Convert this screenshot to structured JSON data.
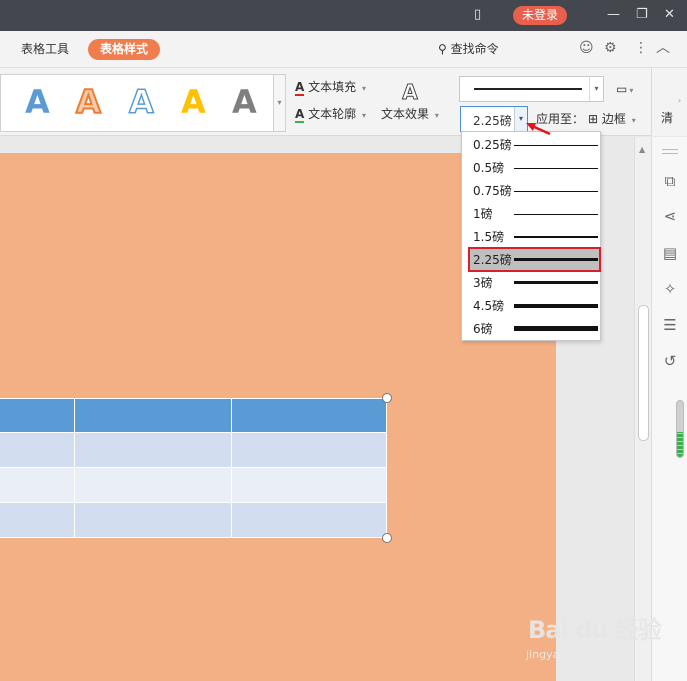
{
  "titlebar": {
    "login_label": "未登录"
  },
  "menubar": {
    "tabs": [
      {
        "label": "表格工具"
      },
      {
        "label": "表格样式"
      }
    ],
    "search_label": "查找命令"
  },
  "ribbon": {
    "text_fill_label": "文本填充",
    "text_outline_label": "文本轮廓",
    "text_effect_label": "文本效果",
    "art_letter": "A",
    "line_weight_value": "2.25磅",
    "apply_to_label": "应用至：",
    "border_label": "边框",
    "clear_label": "清"
  },
  "weight_dropdown": {
    "items": [
      {
        "label": "0.25磅"
      },
      {
        "label": "0.5磅"
      },
      {
        "label": "0.75磅"
      },
      {
        "label": "1磅"
      },
      {
        "label": "1.5磅"
      },
      {
        "label": "2.25磅",
        "selected": true
      },
      {
        "label": "3磅"
      },
      {
        "label": "4.5磅"
      },
      {
        "label": "6磅"
      }
    ]
  },
  "watermark": {
    "logo": "Bai du 经验",
    "sub": "jingyan.baidu.com"
  },
  "colors": {
    "page_background": "#f4b085",
    "table_header": "#5b9bd5",
    "table_band_dark": "#d2deef",
    "table_band_light": "#eaeff7",
    "active_tab": "#f17c4d",
    "selection_outline": "#d9202a"
  }
}
